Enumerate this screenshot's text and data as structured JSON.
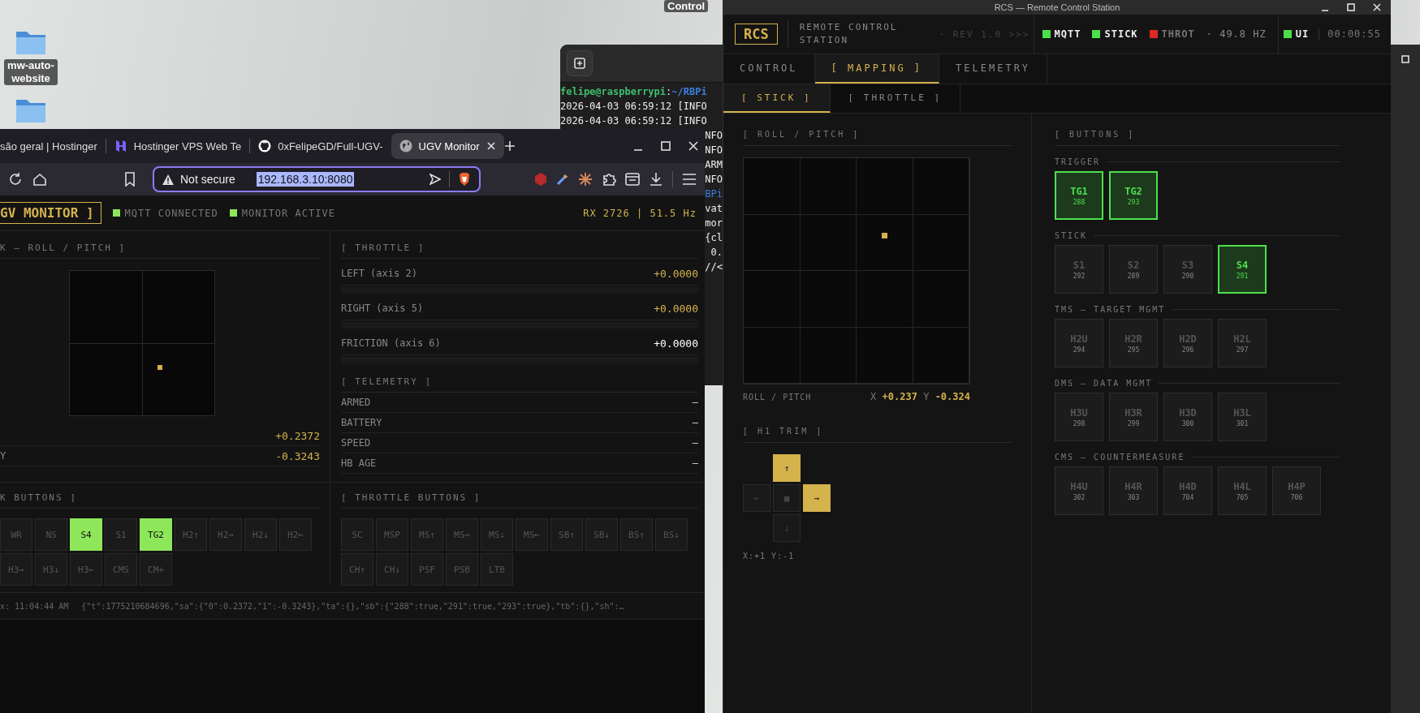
{
  "desktop": {
    "label": "Control",
    "icons": [
      {
        "kind": "folder",
        "label": "mw-auto-website"
      },
      {
        "kind": "folder"
      }
    ]
  },
  "terminal": {
    "lines": [
      {
        "kind": "prompt",
        "user": "felipe@raspberrypi",
        "separator": ":",
        "path": "~/RBPi"
      },
      {
        "kind": "log",
        "text": "2026-04-03 06:59:12 [INFO"
      },
      {
        "kind": "log",
        "text": "2026-04-03 06:59:12 [INFO"
      },
      {
        "kind": "tail",
        "text": "NFO"
      },
      {
        "kind": "tail",
        "text": "NFO"
      },
      {
        "kind": "tail",
        "text": "ARM"
      },
      {
        "kind": "tail",
        "text": "NFO"
      },
      {
        "kind": "tail_path",
        "text": "BPi"
      },
      {
        "kind": "tail",
        "text": "vat"
      },
      {
        "kind": "tail",
        "text": "mor"
      },
      {
        "kind": "tail",
        "text": "{cl"
      },
      {
        "kind": "tail",
        "text": "0."
      },
      {
        "kind": "tail",
        "text": "//<"
      }
    ]
  },
  "browser": {
    "tabs": [
      {
        "kind": "plain",
        "title": "são geral | Hostinger",
        "selected": false
      },
      {
        "kind": "hostinger",
        "title": "Hostinger VPS Web Te",
        "selected": false
      },
      {
        "kind": "github",
        "title": "0xFelipeGD/Full-UGV-",
        "selected": false
      },
      {
        "kind": "globe",
        "title": "UGV Monitor",
        "selected": true
      }
    ],
    "address": {
      "security": "Not secure",
      "url": "192.168.3.10:8080",
      "selected": true
    },
    "page": {
      "header": {
        "title": "GV MONITOR ]",
        "indicators": [
          {
            "label": "MQTT CONNECTED",
            "on": true
          },
          {
            "label": "MONITOR ACTIVE",
            "on": true
          }
        ],
        "stats": "RX 2726 | 51.5 Hz"
      },
      "stick": {
        "title": "K — ROLL / PITCH ]",
        "readings": [
          {
            "value": "+0.2372"
          },
          {
            "label": "Y",
            "value": "-0.3243"
          }
        ]
      },
      "throttle": {
        "title": "[ THROTTLE ]",
        "axes": [
          {
            "label": "LEFT (axis 2)",
            "value": "+0.0000",
            "color": "#d4b24c"
          },
          {
            "label": "RIGHT (axis 5)",
            "value": "+0.0000",
            "color": "#d4b24c"
          },
          {
            "label": "FRICTION (axis 6)",
            "value": "+0.0000",
            "color": "#ffffff"
          }
        ]
      },
      "telemetry": {
        "title": "[ TELEMETRY ]",
        "rows": [
          {
            "label": "ARMED",
            "value": "—"
          },
          {
            "label": "BATTERY",
            "value": "—"
          },
          {
            "label": "SPEED",
            "value": "—"
          },
          {
            "label": "HB AGE",
            "value": "—"
          }
        ]
      },
      "stick_buttons": {
        "title": "K BUTTONS ]",
        "buttons": [
          {
            "label": "WR",
            "on": false
          },
          {
            "label": "NS",
            "on": false
          },
          {
            "label": "S4",
            "on": true
          },
          {
            "label": "S1",
            "on": false
          },
          {
            "label": "TG2",
            "on": true
          },
          {
            "label": "H2↑",
            "on": false
          },
          {
            "label": "H2→",
            "on": false
          },
          {
            "label": "H2↓",
            "on": false
          },
          {
            "label": "H2←",
            "on": false
          },
          {
            "label": "H3→",
            "on": false
          },
          {
            "label": "H3↓",
            "on": false
          },
          {
            "label": "H3←",
            "on": false
          },
          {
            "label": "CMS",
            "on": false
          },
          {
            "label": "CM+",
            "on": false
          }
        ]
      },
      "throttle_buttons": {
        "title": "[ THROTTLE BUTTONS ]",
        "buttons": [
          {
            "label": "SC",
            "on": false
          },
          {
            "label": "MSP",
            "on": false
          },
          {
            "label": "MS↑",
            "on": false
          },
          {
            "label": "MS→",
            "on": false
          },
          {
            "label": "MS↓",
            "on": false
          },
          {
            "label": "MS←",
            "on": false
          },
          {
            "label": "SB↑",
            "on": false
          },
          {
            "label": "SB↓",
            "on": false
          },
          {
            "label": "BS↑",
            "on": false
          },
          {
            "label": "BS↓",
            "on": false
          },
          {
            "label": "CH↑",
            "on": false
          },
          {
            "label": "CH↓",
            "on": false
          },
          {
            "label": "PSF",
            "on": false
          },
          {
            "label": "PSB",
            "on": false
          },
          {
            "label": "LTB",
            "on": false
          }
        ]
      },
      "status": {
        "time": "x: 11:04:44 AM",
        "payload": "{\"t\":1775210684696,\"sa\":{\"0\":0.2372,\"1\":-0.3243},\"ta\":{},\"sb\":{\"288\":true,\"291\":true,\"293\":true},\"tb\":{},\"sh\":…"
      }
    }
  },
  "rcs": {
    "title": "RCS — Remote Control Station",
    "header": {
      "logo": "RCS",
      "name": "REMOTE CONTROL STATION",
      "rev": "· REV 1.0 >>>",
      "indicators": [
        {
          "label": "MQTT",
          "color": "#4be04b",
          "on": true
        },
        {
          "label": "STICK",
          "color": "#4be04b",
          "on": true
        },
        {
          "label": "THROT",
          "color": "#e02828",
          "on": false
        }
      ],
      "rate": "· 49.8 HZ",
      "ui": {
        "label": "UI",
        "color": "#4be04b",
        "on": true
      },
      "clock": "00:00:55"
    },
    "tabs": [
      {
        "label": "CONTROL",
        "selected": false
      },
      {
        "label": "[ MAPPING ]",
        "selected": true
      },
      {
        "label": "TELEMETRY",
        "selected": false
      }
    ],
    "subtabs": [
      {
        "label": "[ STICK ]",
        "selected": true
      },
      {
        "label": "[ THROTTLE ]",
        "selected": false
      }
    ],
    "roll_pitch": {
      "title": "[ ROLL / PITCH ]",
      "caption": "ROLL / PITCH",
      "x_label": "X",
      "x_value": "+0.237",
      "y_label": "Y",
      "y_value": "-0.324"
    },
    "trim": {
      "title": "[ H1 TRIM ]",
      "pad": [
        {
          "kind": "up",
          "glyph": "↑",
          "on": true
        },
        {
          "kind": "left",
          "glyph": "←",
          "on": false
        },
        {
          "kind": "center",
          "glyph": "■",
          "on": false
        },
        {
          "kind": "right",
          "glyph": "→",
          "on": true
        },
        {
          "kind": "down",
          "glyph": "↓",
          "on": false
        }
      ],
      "readout": "X:+1 Y:-1"
    },
    "buttons": {
      "title": "[ BUTTONS ]",
      "groups": [
        {
          "label": "TRIGGER",
          "buttons": [
            {
              "label": "TG1",
              "code": "288",
              "on": true
            },
            {
              "label": "TG2",
              "code": "293",
              "on": true
            }
          ]
        },
        {
          "label": "STICK",
          "buttons": [
            {
              "label": "S1",
              "code": "292",
              "on": false
            },
            {
              "label": "S2",
              "code": "289",
              "on": false
            },
            {
              "label": "S3",
              "code": "290",
              "on": false
            },
            {
              "label": "S4",
              "code": "291",
              "on": true
            }
          ]
        },
        {
          "label": "TMS — TARGET MGMT",
          "buttons": [
            {
              "label": "H2U",
              "code": "294",
              "on": false
            },
            {
              "label": "H2R",
              "code": "295",
              "on": false
            },
            {
              "label": "H2D",
              "code": "296",
              "on": false
            },
            {
              "label": "H2L",
              "code": "297",
              "on": false
            }
          ]
        },
        {
          "label": "DMS — DATA MGMT",
          "buttons": [
            {
              "label": "H3U",
              "code": "298",
              "on": false
            },
            {
              "label": "H3R",
              "code": "299",
              "on": false
            },
            {
              "label": "H3D",
              "code": "300",
              "on": false
            },
            {
              "label": "H3L",
              "code": "301",
              "on": false
            }
          ]
        },
        {
          "label": "CMS — COUNTERMEASURE",
          "buttons": [
            {
              "label": "H4U",
              "code": "302",
              "on": false
            },
            {
              "label": "H4R",
              "code": "303",
              "on": false
            },
            {
              "label": "H4D",
              "code": "704",
              "on": false
            },
            {
              "label": "H4L",
              "code": "705",
              "on": false
            },
            {
              "label": "H4P",
              "code": "706",
              "on": false
            }
          ]
        }
      ]
    }
  }
}
